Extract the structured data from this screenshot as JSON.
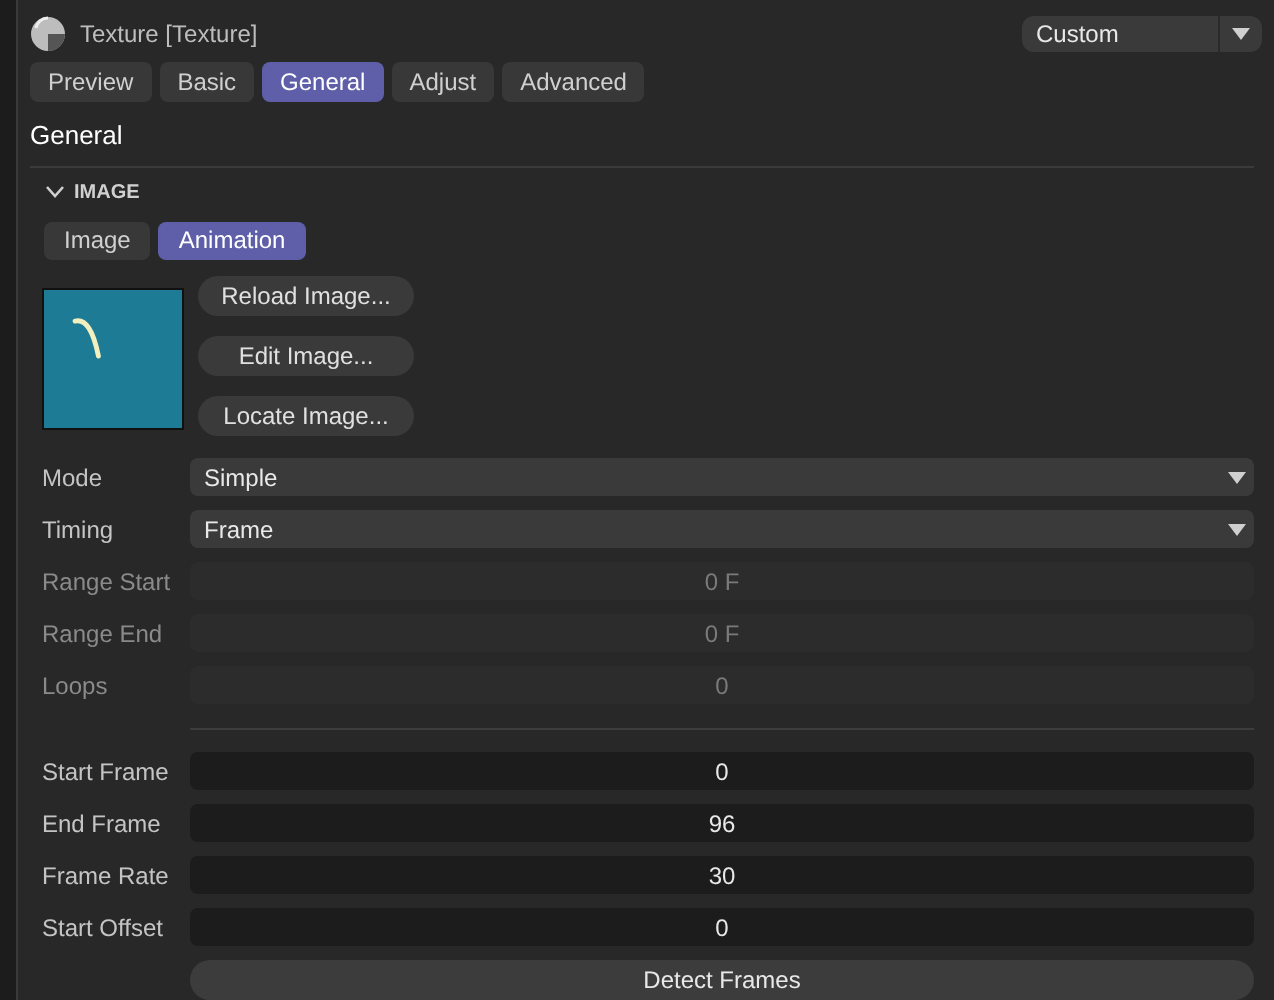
{
  "header": {
    "title": "Texture [Texture]",
    "preset": "Custom"
  },
  "tabs": [
    {
      "label": "Preview",
      "selected": false
    },
    {
      "label": "Basic",
      "selected": false
    },
    {
      "label": "General",
      "selected": true
    },
    {
      "label": "Adjust",
      "selected": false
    },
    {
      "label": "Advanced",
      "selected": false
    }
  ],
  "section_title": "General",
  "group": {
    "title": "IMAGE",
    "expanded": true
  },
  "subtabs": [
    {
      "label": "Image",
      "selected": false
    },
    {
      "label": "Animation",
      "selected": true
    }
  ],
  "image_buttons": [
    "Reload Image...",
    "Edit Image...",
    "Locate Image..."
  ],
  "fields": [
    {
      "label": "Mode",
      "kind": "select",
      "value": "Simple",
      "disabled": false
    },
    {
      "label": "Timing",
      "kind": "select",
      "value": "Frame",
      "disabled": false
    },
    {
      "label": "Range Start",
      "kind": "number",
      "value": "0 F",
      "disabled": true
    },
    {
      "label": "Range End",
      "kind": "number",
      "value": "0 F",
      "disabled": true
    },
    {
      "label": "Loops",
      "kind": "number",
      "value": "0",
      "disabled": true
    },
    {
      "kind": "divider"
    },
    {
      "label": "Start Frame",
      "kind": "number",
      "value": "0",
      "disabled": false
    },
    {
      "label": "End Frame",
      "kind": "number",
      "value": "96",
      "disabled": false
    },
    {
      "label": "Frame Rate",
      "kind": "number",
      "value": "30",
      "disabled": false
    },
    {
      "label": "Start Offset",
      "kind": "number",
      "value": "0",
      "disabled": false
    }
  ],
  "action_button": "Detect Frames"
}
